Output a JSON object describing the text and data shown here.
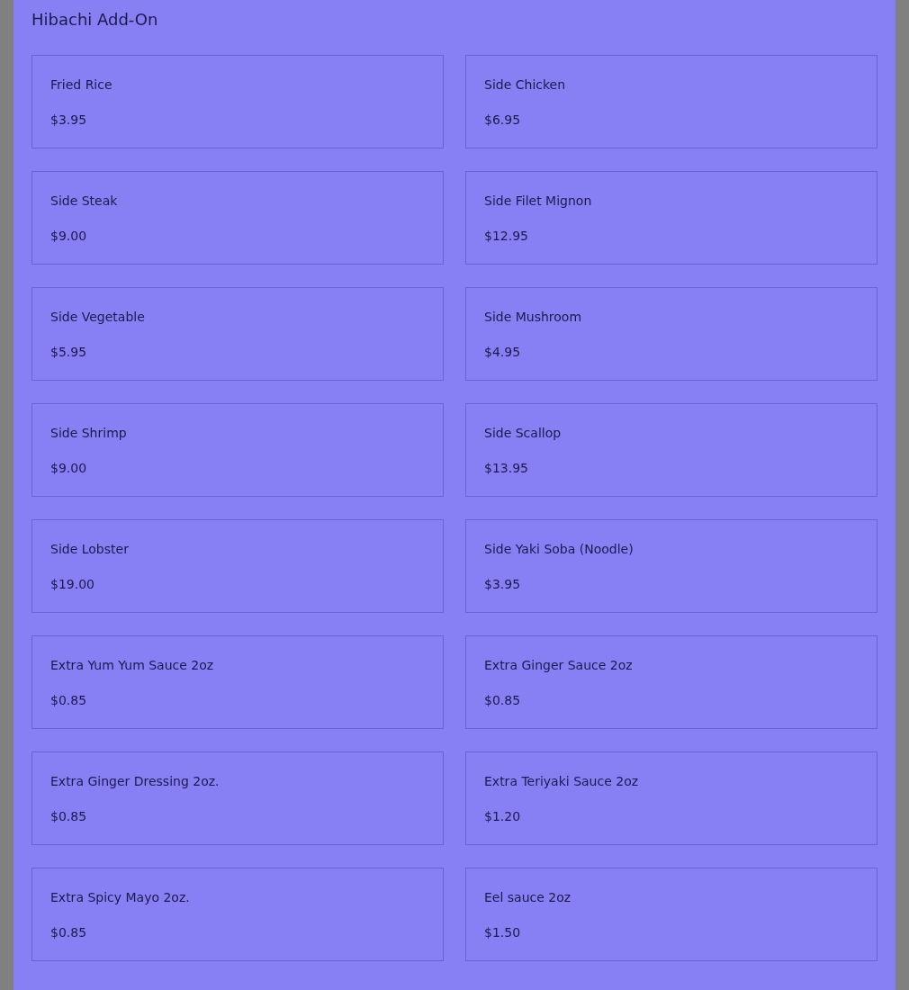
{
  "section": {
    "title": "Hibachi Add-On"
  },
  "items": [
    {
      "name": "Fried Rice",
      "price": "$3.95"
    },
    {
      "name": "Side Chicken",
      "price": "$6.95"
    },
    {
      "name": "Side Steak",
      "price": "$9.00"
    },
    {
      "name": "Side Filet Mignon",
      "price": "$12.95"
    },
    {
      "name": "Side Vegetable",
      "price": "$5.95"
    },
    {
      "name": "Side Mushroom",
      "price": "$4.95"
    },
    {
      "name": "Side Shrimp",
      "price": "$9.00"
    },
    {
      "name": "Side Scallop",
      "price": "$13.95"
    },
    {
      "name": "Side Lobster",
      "price": "$19.00"
    },
    {
      "name": "Side Yaki Soba (Noodle)",
      "price": "$3.95"
    },
    {
      "name": "Extra Yum Yum Sauce 2oz",
      "price": "$0.85"
    },
    {
      "name": "Extra Ginger Sauce 2oz",
      "price": "$0.85"
    },
    {
      "name": "Extra Ginger Dressing 2oz.",
      "price": "$0.85"
    },
    {
      "name": "Extra Teriyaki Sauce 2oz",
      "price": "$1.20"
    },
    {
      "name": "Extra Spicy Mayo 2oz.",
      "price": "$0.85"
    },
    {
      "name": "Eel sauce 2oz",
      "price": "$1.50"
    }
  ]
}
